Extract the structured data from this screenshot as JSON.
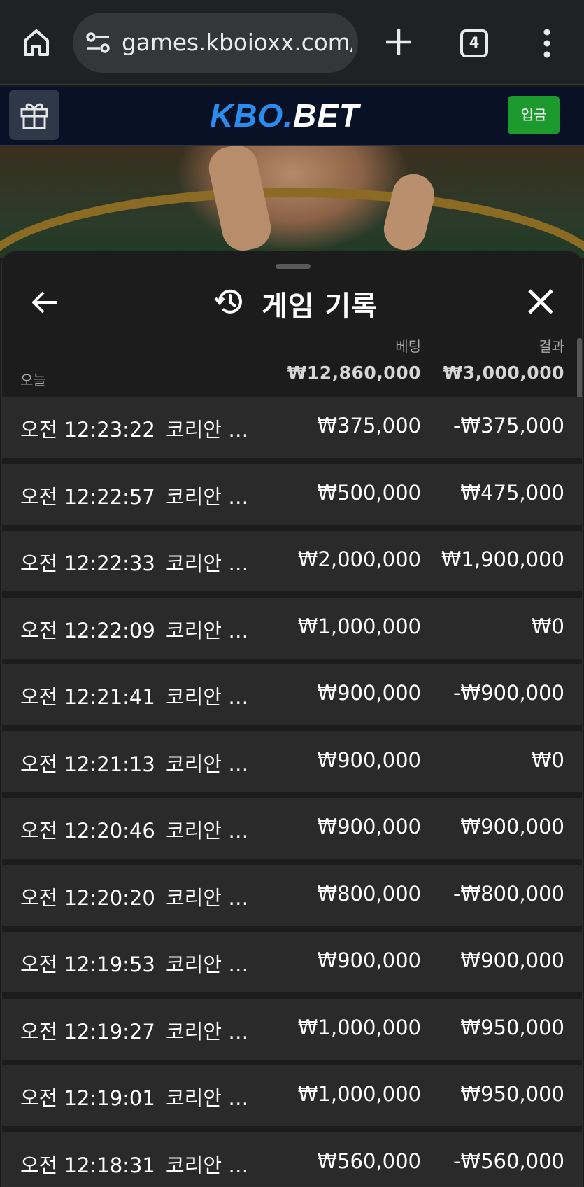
{
  "browser": {
    "url": "games.kboioxx.com/",
    "tab_count": "4"
  },
  "site": {
    "logo_kbo": "KBO.",
    "logo_bet": "BET",
    "deposit_label": "입금"
  },
  "history": {
    "title": "게임 기록",
    "bet_header": "베팅",
    "result_header": "결과",
    "today_label": "오늘",
    "total_bet": "₩12,860,000",
    "total_result": "₩3,000,000",
    "rows": [
      {
        "time": "오전 12:23:22",
        "game": "코리안 스...",
        "bet": "₩375,000",
        "result": "-₩375,000"
      },
      {
        "time": "오전 12:22:57",
        "game": "코리안 스...",
        "bet": "₩500,000",
        "result": "₩475,000"
      },
      {
        "time": "오전 12:22:33",
        "game": "코리안 스...",
        "bet": "₩2,000,000",
        "result": "₩1,900,000"
      },
      {
        "time": "오전 12:22:09",
        "game": "코리안 스...",
        "bet": "₩1,000,000",
        "result": "₩0"
      },
      {
        "time": "오전 12:21:41",
        "game": "코리안 스...",
        "bet": "₩900,000",
        "result": "-₩900,000"
      },
      {
        "time": "오전 12:21:13",
        "game": "코리안 스...",
        "bet": "₩900,000",
        "result": "₩0"
      },
      {
        "time": "오전 12:20:46",
        "game": "코리안 스...",
        "bet": "₩900,000",
        "result": "₩900,000"
      },
      {
        "time": "오전 12:20:20",
        "game": "코리안 스...",
        "bet": "₩800,000",
        "result": "-₩800,000"
      },
      {
        "time": "오전 12:19:53",
        "game": "코리안 스...",
        "bet": "₩900,000",
        "result": "₩900,000"
      },
      {
        "time": "오전 12:19:27",
        "game": "코리안 스...",
        "bet": "₩1,000,000",
        "result": "₩950,000"
      },
      {
        "time": "오전 12:19:01",
        "game": "코리안 스...",
        "bet": "₩1,000,000",
        "result": "₩950,000"
      },
      {
        "time": "오전 12:18:31",
        "game": "코리안 스...",
        "bet": "₩560,000",
        "result": "-₩560,000"
      }
    ]
  },
  "icons": {
    "home": "home-icon",
    "site_settings": "tune-icon",
    "new_tab": "plus-icon",
    "menu": "more-vert-icon",
    "gift": "gift-icon",
    "back": "arrow-left-icon",
    "history": "history-icon",
    "close": "close-icon"
  },
  "colors": {
    "brand_blue": "#2b8cf0",
    "deposit_green": "#1d9a2e",
    "sheet_bg": "#1c1c1c",
    "row_bg": "#2a2a2a"
  }
}
